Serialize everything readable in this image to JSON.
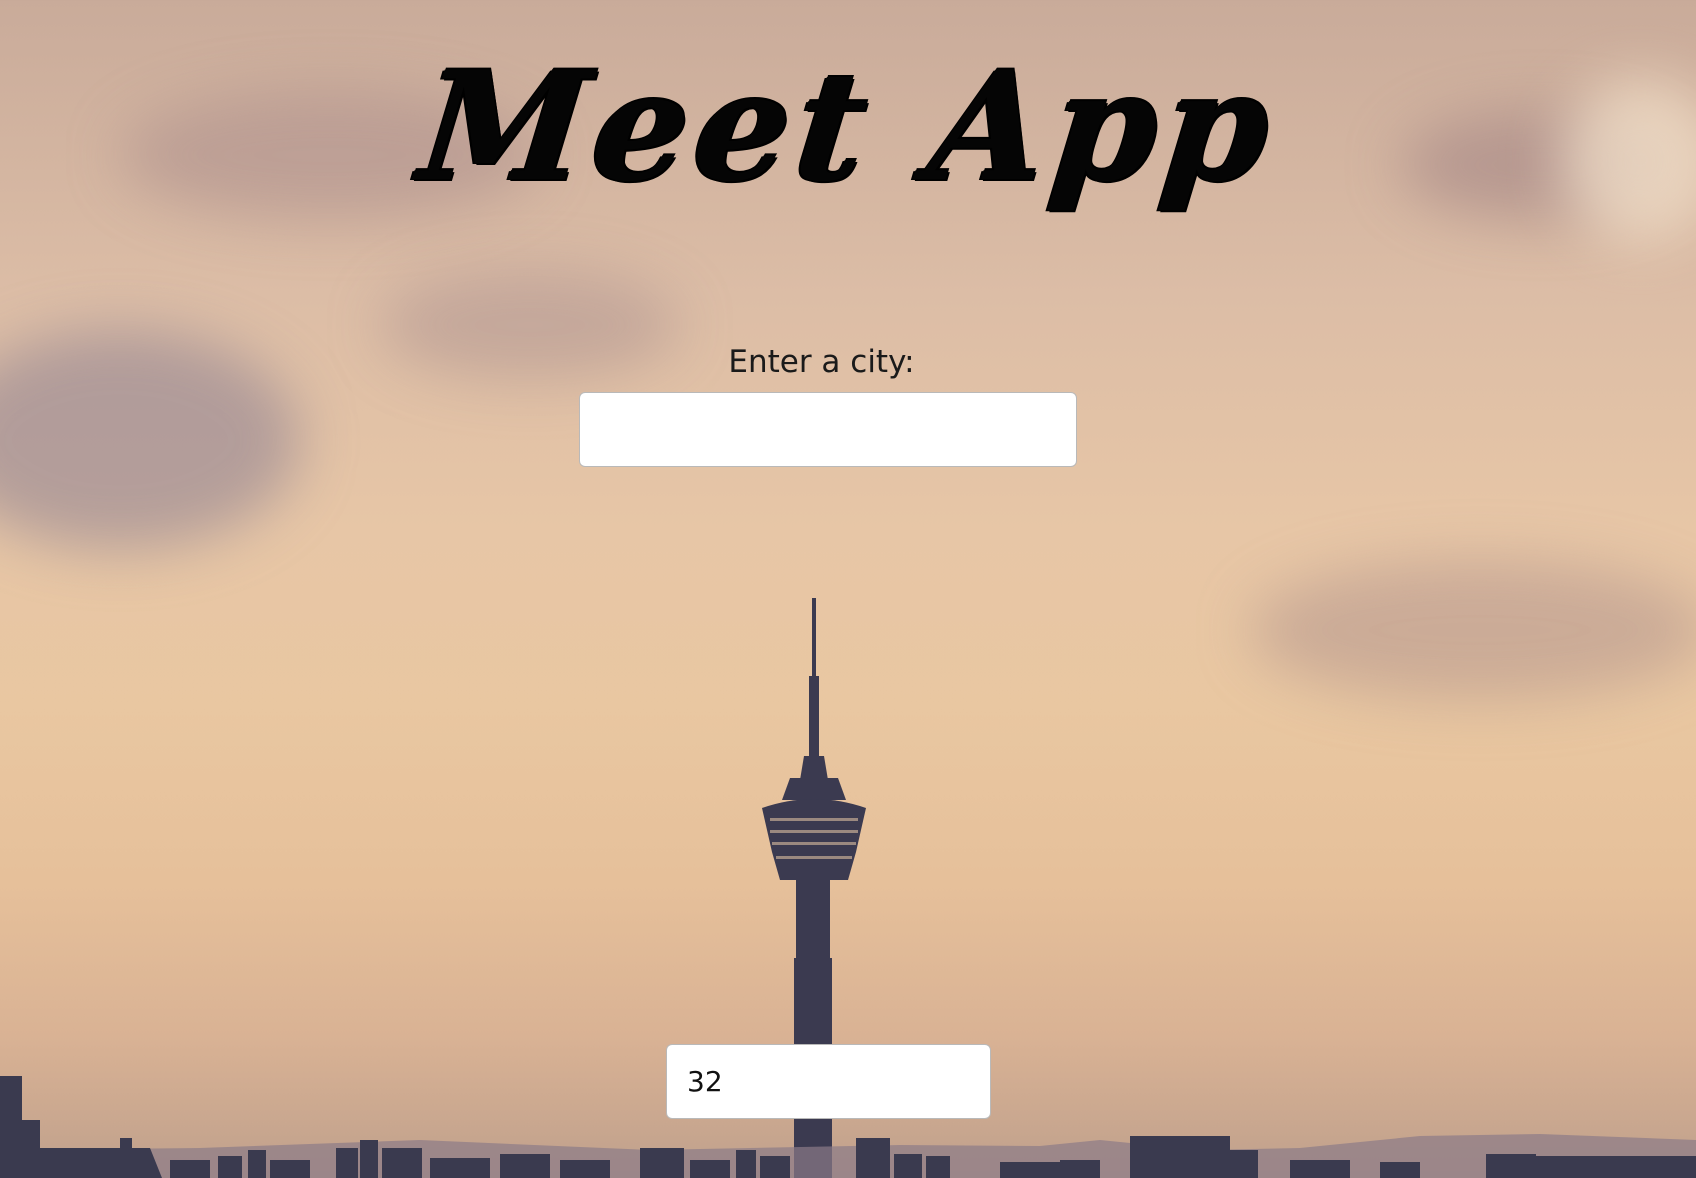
{
  "app": {
    "title": "Meet App"
  },
  "city_search": {
    "label": "Enter a city:",
    "value": "",
    "placeholder": ""
  },
  "number_of_events": {
    "value": "32"
  },
  "background": {
    "description_icon": "city-skyline-tower-background",
    "sky_color": "#e7c6a6",
    "silhouette_color": "#3a3a4f"
  }
}
